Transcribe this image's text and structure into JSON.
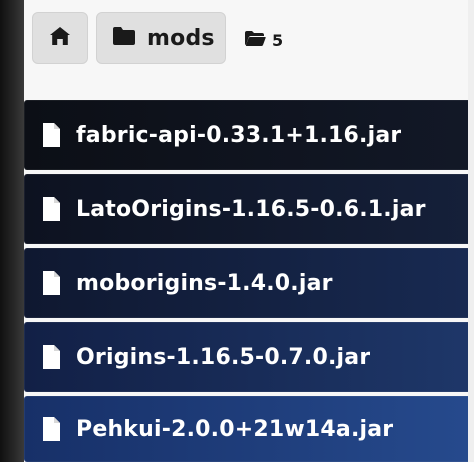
{
  "breadcrumb": {
    "home_icon": "home-icon",
    "mods_label": "mods",
    "folder_icon": "folder-icon",
    "folder_count_icon": "folder-open-icon",
    "folder_count": "5"
  },
  "files": [
    {
      "icon": "file-icon",
      "name": "fabric-api-0.33.1+1.16.jar"
    },
    {
      "icon": "file-icon",
      "name": "LatoOrigins-1.16.5-0.6.1.jar"
    },
    {
      "icon": "file-icon",
      "name": "moborigins-1.4.0.jar"
    },
    {
      "icon": "file-icon",
      "name": "Origins-1.16.5-0.7.0.jar"
    },
    {
      "icon": "file-icon",
      "name": "Pehkui-2.0.0+21w14a.jar"
    }
  ],
  "colors": {
    "breadcrumb_button_bg": "#e0e0e0",
    "row_text": "#ffffff"
  }
}
